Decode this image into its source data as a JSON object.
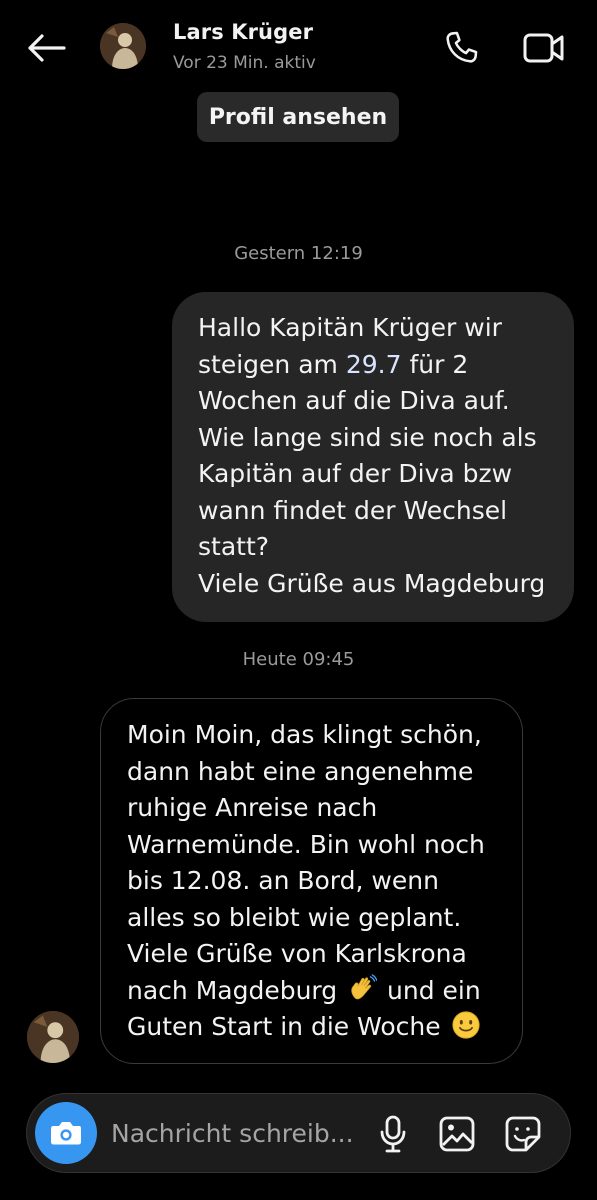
{
  "header": {
    "back_icon": "arrow-left-icon",
    "contact_name": "Lars Krüger",
    "contact_status": "Vor 23 Min. aktiv",
    "call_icon": "phone-icon",
    "video_icon": "video-camera-icon"
  },
  "profile_button_label": "Profil ansehen",
  "messages": [
    {
      "timestamp": "Gestern 12:19",
      "direction": "outgoing",
      "text_before": "Hallo Kapitän Krüger wir\nsteigen am ",
      "linked_date": "29.7",
      "text_after": " für 2\nWochen auf die Diva auf.\nWie lange sind sie noch als\nKapitän auf der Diva bzw\nwann findet der Wechsel\nstatt?\nViele Grüße aus Magdeburg"
    },
    {
      "timestamp": "Heute 09:45",
      "direction": "incoming",
      "text_part1": "Moin Moin, das klingt schön,\ndann habt eine angenehme\nruhige Anreise nach\nWarnemünde. Bin wohl noch\nbis 12.08. an Bord, wenn\nalles so bleibt wie geplant.\nViele Grüße von Karlskrona\nnach Magdeburg",
      "emoji1": "waving-hand-emoji",
      "text_part2": " und ein\nGuten Start in die Woche",
      "emoji2": "smiling-face-emoji"
    }
  ],
  "composer": {
    "placeholder": "Nachricht schreib...",
    "camera_icon": "camera-icon",
    "mic_icon": "microphone-icon",
    "gallery_icon": "image-icon",
    "sticker_icon": "sticker-icon"
  },
  "colors": {
    "background": "#000000",
    "outgoing_bubble": "#262626",
    "accent_blue": "#3797f0",
    "secondary_text": "#9a9a9a"
  }
}
